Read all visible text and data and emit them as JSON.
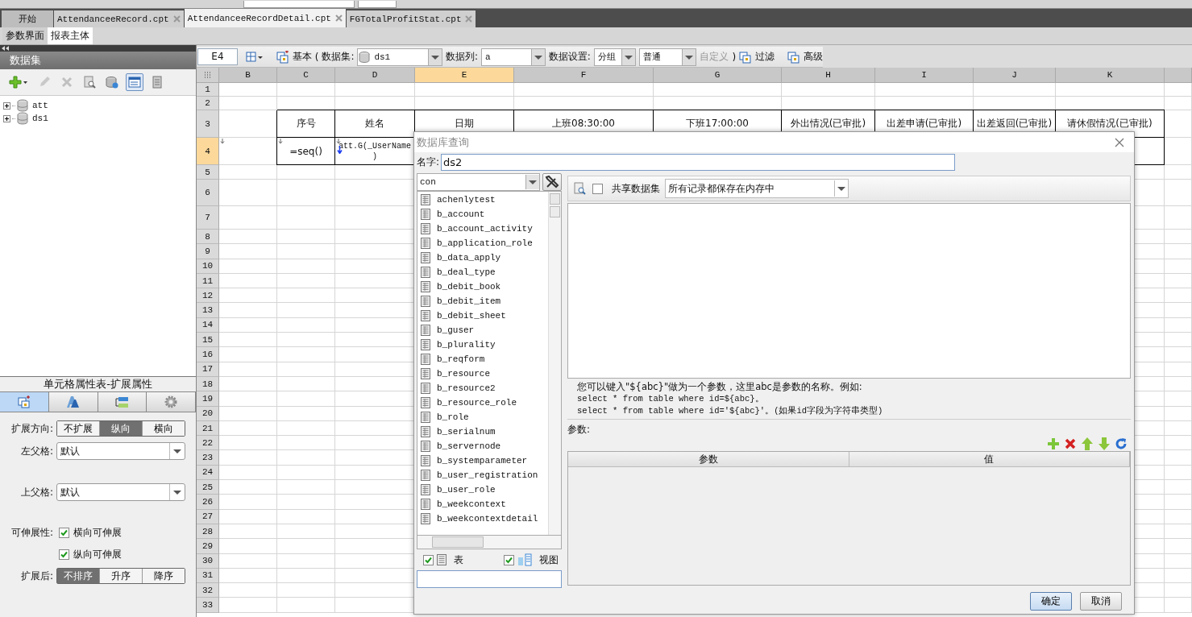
{
  "document_tabs": [
    {
      "label": "开始",
      "closable": false,
      "selected": false
    },
    {
      "label": "AttendanceeRecord.cpt",
      "closable": true,
      "selected": false
    },
    {
      "label": "AttendanceeRecordDetail.cpt",
      "closable": true,
      "selected": true
    },
    {
      "label": "FGTotalProfitStat.cpt",
      "closable": true,
      "selected": false
    }
  ],
  "view_tabs": [
    {
      "label": "参数界面",
      "selected": false
    },
    {
      "label": "报表主体",
      "selected": true
    }
  ],
  "dataset_panel": {
    "title": "数据集",
    "tools": [
      {
        "kind": "add",
        "disabled": false,
        "selected": false
      },
      {
        "kind": "edit",
        "disabled": true,
        "selected": false
      },
      {
        "kind": "delete",
        "disabled": true,
        "selected": false
      },
      {
        "kind": "preview",
        "disabled": false,
        "selected": false
      },
      {
        "kind": "connection",
        "disabled": false,
        "selected": false
      },
      {
        "kind": "form",
        "disabled": false,
        "selected": true
      },
      {
        "kind": "server",
        "disabled": false,
        "selected": false
      }
    ],
    "tree": [
      {
        "label": "att",
        "expanded": false
      },
      {
        "label": "ds1",
        "expanded": false
      }
    ]
  },
  "cell_properties": {
    "title": "单元格属性表-扩展属性",
    "tabs": [
      {
        "kind": "expand",
        "selected": true
      },
      {
        "kind": "style",
        "selected": false
      },
      {
        "kind": "condition",
        "selected": false
      },
      {
        "kind": "settings",
        "selected": false
      }
    ],
    "expand_direction": {
      "label": "扩展方向:",
      "options": [
        {
          "label": "不扩展",
          "selected": false
        },
        {
          "label": "纵向",
          "selected": true
        },
        {
          "label": "横向",
          "selected": false
        }
      ]
    },
    "left_parent": {
      "label": "左父格:",
      "value": "默认"
    },
    "top_parent": {
      "label": "上父格:",
      "value": "默认"
    },
    "stretch": {
      "label": "可伸展性:",
      "options": [
        {
          "label": "横向可伸展",
          "checked": true
        },
        {
          "label": "纵向可伸展",
          "checked": true
        }
      ]
    },
    "after_expand": {
      "label": "扩展后:",
      "options": [
        {
          "label": "不排序",
          "selected": true
        },
        {
          "label": "升序",
          "selected": false
        },
        {
          "label": "降序",
          "selected": false
        }
      ]
    }
  },
  "cell_toolbar": {
    "cell_ref": "E4",
    "basic": "基本",
    "open_paren": "(",
    "dataset_label": "数据集:",
    "dataset": "ds1",
    "column_label": "数据列:",
    "column": "a",
    "setting_label": "数据设置:",
    "setting": "分组",
    "mode": "普通",
    "custom": {
      "label": "自定义",
      "disabled": true
    },
    "close_paren": ")",
    "filter": "过滤",
    "advanced": "高级"
  },
  "sheet": {
    "columns": [
      {
        "label": "B",
        "selected": false
      },
      {
        "label": "C",
        "selected": false
      },
      {
        "label": "D",
        "selected": false
      },
      {
        "label": "E",
        "selected": true
      },
      {
        "label": "F",
        "selected": false
      },
      {
        "label": "G",
        "selected": false
      },
      {
        "label": "H",
        "selected": false
      },
      {
        "label": "I",
        "selected": false
      },
      {
        "label": "J",
        "selected": false
      },
      {
        "label": "K",
        "selected": false
      }
    ],
    "rows": [
      {
        "label": "1",
        "selected": false
      },
      {
        "label": "2",
        "selected": false
      },
      {
        "label": "3",
        "selected": false,
        "cells": [
          {},
          {
            "text": "序号",
            "boxed": true
          },
          {
            "text": "姓名",
            "boxed": true
          },
          {
            "text": "日期",
            "boxed": true
          },
          {
            "text": "上班08:30:00",
            "boxed": true
          },
          {
            "text": "下班17:00:00",
            "boxed": true
          },
          {
            "text": "外出情况(已审批)",
            "boxed": true
          },
          {
            "text": "出差申请(已审批)",
            "boxed": true
          },
          {
            "text": "出差返回(已审批)",
            "boxed": true
          },
          {
            "text": "请休假情况(已审批)",
            "boxed": true
          }
        ]
      },
      {
        "label": "4",
        "selected": true,
        "cells": [
          {
            "expand": true
          },
          {
            "text": "=seq()",
            "boxed": true,
            "expand": true
          },
          {
            "lines": [
              "att.G(_UserName",
              ")"
            ],
            "boxed": true,
            "expand": true,
            "bound": true
          },
          {},
          {},
          {},
          {},
          {},
          {},
          {
            "boxed": true
          }
        ]
      },
      {
        "label": "5",
        "selected": false
      },
      {
        "label": "6",
        "selected": false
      },
      {
        "label": "7",
        "selected": false
      },
      {
        "label": "8",
        "selected": false
      },
      {
        "label": "9",
        "selected": false
      },
      {
        "label": "10",
        "selected": false
      },
      {
        "label": "11",
        "selected": false
      },
      {
        "label": "12",
        "selected": false
      },
      {
        "label": "13",
        "selected": false
      },
      {
        "label": "14",
        "selected": false
      },
      {
        "label": "15",
        "selected": false
      },
      {
        "label": "16",
        "selected": false
      },
      {
        "label": "17",
        "selected": false
      },
      {
        "label": "18",
        "selected": false
      },
      {
        "label": "19",
        "selected": false
      },
      {
        "label": "20",
        "selected": false
      },
      {
        "label": "21",
        "selected": false
      },
      {
        "label": "22",
        "selected": false
      },
      {
        "label": "23",
        "selected": false
      },
      {
        "label": "24",
        "selected": false
      },
      {
        "label": "25",
        "selected": false
      },
      {
        "label": "26",
        "selected": false
      },
      {
        "label": "27",
        "selected": false
      },
      {
        "label": "28",
        "selected": false
      },
      {
        "label": "29",
        "selected": false
      },
      {
        "label": "30",
        "selected": false
      },
      {
        "label": "31",
        "selected": false
      },
      {
        "label": "32",
        "selected": false
      },
      {
        "label": "33",
        "selected": false
      }
    ]
  },
  "dialog": {
    "title": "数据库查询",
    "name_label": "名字:",
    "name": "ds2",
    "connection": "con",
    "tables": [
      "achenlytest",
      "b_account",
      "b_account_activity",
      "b_application_role",
      "b_data_apply",
      "b_deal_type",
      "b_debit_book",
      "b_debit_item",
      "b_debit_sheet",
      "b_guser",
      "b_plurality",
      "b_reqform",
      "b_resource",
      "b_resource2",
      "b_resource_role",
      "b_role",
      "b_serialnum",
      "b_servernode",
      "b_systemparameter",
      "b_user_registration",
      "b_user_role",
      "b_weekcontext",
      "b_weekcontextdetail"
    ],
    "show_tables": {
      "label": "表",
      "checked": true
    },
    "show_views": {
      "label": "视图",
      "checked": true
    },
    "share": {
      "label": "共享数据集",
      "checked": false
    },
    "cache_mode": "所有记录都保存在内存中",
    "hint": [
      "您可以键入\"${abc}\"做为一个参数，这里abc是参数的名称。例如:",
      "select * from table where id=${abc}。",
      "select * from table where id='${abc}'。(如果id字段为字符串类型)"
    ],
    "params_label": "参数:",
    "param_columns": [
      "参数",
      "值"
    ],
    "buttons": [
      {
        "label": "确定",
        "default": true
      },
      {
        "label": "取消",
        "default": false
      }
    ]
  }
}
